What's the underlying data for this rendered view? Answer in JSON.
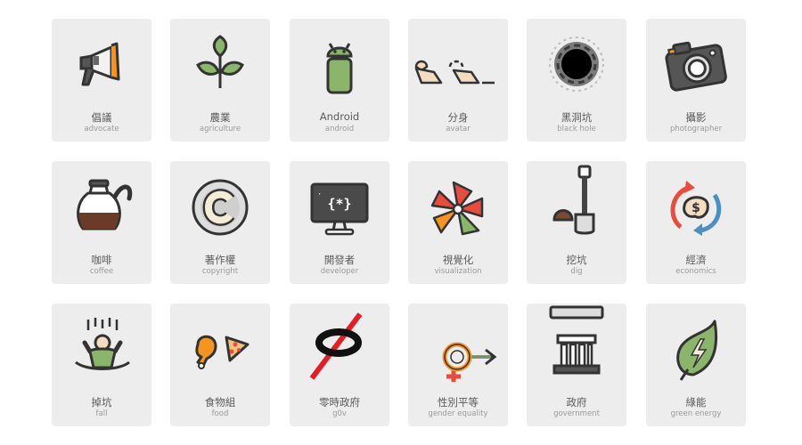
{
  "cards": [
    {
      "zh": "倡議",
      "en": "advocate",
      "icon": "megaphone-icon"
    },
    {
      "zh": "農業",
      "en": "agriculture",
      "icon": "sprout-icon"
    },
    {
      "zh": "Android",
      "en": "android",
      "icon": "android-icon"
    },
    {
      "zh": "分身",
      "en": "avatar",
      "icon": "avatar-icon"
    },
    {
      "zh": "黑洞坑",
      "en": "black hole",
      "icon": "black-hole-icon"
    },
    {
      "zh": "攝影",
      "en": "photographer",
      "icon": "camera-icon"
    },
    {
      "zh": "咖啡",
      "en": "coffee",
      "icon": "coffee-pot-icon"
    },
    {
      "zh": "著作權",
      "en": "copyright",
      "icon": "copyright-icon"
    },
    {
      "zh": "開發者",
      "en": "developer",
      "icon": "monitor-code-icon"
    },
    {
      "zh": "視覺化",
      "en": "visualization",
      "icon": "pinwheel-chart-icon"
    },
    {
      "zh": "挖坑",
      "en": "dig",
      "icon": "shovel-icon"
    },
    {
      "zh": "經濟",
      "en": "economics",
      "icon": "money-cycle-icon"
    },
    {
      "zh": "掉坑",
      "en": "fall",
      "icon": "falling-person-icon"
    },
    {
      "zh": "食物組",
      "en": "food",
      "icon": "drumstick-pizza-icon"
    },
    {
      "zh": "零時政府",
      "en": "g0v",
      "icon": "g0v-logo-icon"
    },
    {
      "zh": "性別平等",
      "en": "gender equality",
      "icon": "gender-symbols-icon"
    },
    {
      "zh": "政府",
      "en": "government",
      "icon": "government-building-icon"
    },
    {
      "zh": "綠能",
      "en": "green energy",
      "icon": "leaf-bolt-icon"
    }
  ]
}
